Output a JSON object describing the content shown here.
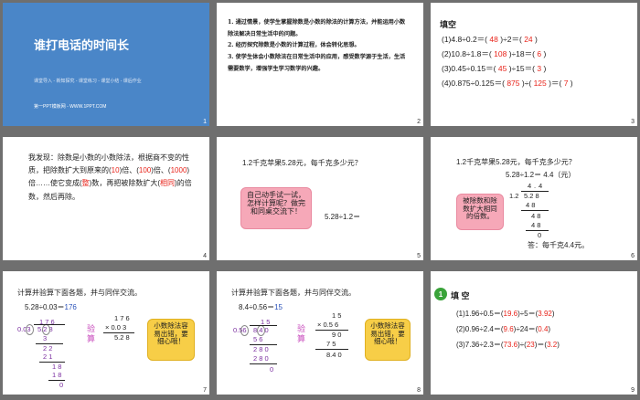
{
  "slide1": {
    "title": "谁打电话的时间长",
    "subtitle": "课堂导入 - 新知探究 - 课堂练习 - 课堂小结 - 课后作业",
    "website": "第一PPT模板网 - WWW.1PPT.COM",
    "number": "1"
  },
  "slide2": {
    "items": [
      "1. 通过情景，使学生掌握除数是小数的除法的计算方法，并能运用小数除法解决日常生活中的问题。",
      "2. 经历探究除数是小数的计算过程，体会转化思想。",
      "3. 使学生体会小数除法在日常生活中的应用，感受数学源于生活，生活需要数学，增强学生学习数学的兴趣。"
    ],
    "number": "2"
  },
  "slide3": {
    "title": "填空",
    "lines": [
      {
        "a": "(1)4.8÷0.2＝(",
        "b": "48",
        "c": ")÷2＝(",
        "d": "24",
        "e": ")"
      },
      {
        "a": "(2)10.8÷1.8＝(",
        "b": "108",
        "c": ")÷18＝(",
        "d": "6",
        "e": ")"
      },
      {
        "a": "(3)0.45÷0.15＝(",
        "b": "45",
        "c": ")÷15＝(",
        "d": "3",
        "e": ")"
      },
      {
        "a": "(4)0.875÷0.125＝(",
        "b": "875",
        "c": ")÷(",
        "d": "125",
        "e": ")＝(",
        "f": "7",
        "g": ")"
      }
    ],
    "number": "3"
  },
  "slide4": {
    "p1": "我发现：除数是小数的小数除法，根据商不变的性质，把除数扩大到原来的(",
    "a1": "10",
    "p2": ")倍、(",
    "a2": "100",
    "p3": ")倍、(",
    "a3": "1000",
    "p4": ")倍……使它变成(",
    "a4": "整",
    "p5": ")数，再把被除数扩大(",
    "a5": "相同",
    "p6": ")的倍数，然后再除。",
    "number": "4"
  },
  "slide5": {
    "question": "1.2千克苹果5.28元，每千克多少元？",
    "bubble": "自己动手试一试，怎样计算呢？做完和同桌交流下！",
    "expr": "5.28÷1.2＝",
    "number": "5"
  },
  "slide6": {
    "question": "1.2千克苹果5.28元，每千克多少元？",
    "expr": "5.28÷1.2＝ 4.4（元）",
    "bubble": "被除数和除数扩大相同的倍数。",
    "answer": "答：每千克4.4元。",
    "div": {
      "q1": "4",
      "q2": ".",
      "q3": "4",
      "divisor": "1.2",
      "dividend": "5.2 8",
      "r1": "4 8",
      "r2": "4 8",
      "r3": "4 8",
      "r4": "0"
    },
    "number": "6"
  },
  "slide7": {
    "header": "计算并验算下面各题，并与同伴交流。",
    "expr": "5.28÷0.03＝",
    "ans": "176",
    "divisor": "0.03",
    "quotient": "1 7 6",
    "dividend": "5.2 8",
    "steps": [
      "3",
      "2 2",
      "2 1",
      "1 8",
      "1 8",
      "0"
    ],
    "check_label": "验算",
    "check": [
      "1 7 6",
      "× 0.0 3",
      "5.2 8"
    ],
    "bubble": "小数除法容易出错，要细心哦！",
    "number": "7"
  },
  "slide8": {
    "header": "计算并验算下面各题，并与同伴交流。",
    "expr": "8.4÷0.56＝",
    "ans": "15",
    "divisor": "0.56",
    "quotient": "1 5",
    "dividend": "8.4 0",
    "steps": [
      "5 6",
      "2 8 0",
      "2 8 0",
      "0"
    ],
    "check_label": "验算",
    "check": [
      "1 5",
      "× 0.5 6",
      "9 0",
      "7 5",
      "8.4 0"
    ],
    "bubble": "小数除法容易出错，要细心哦！",
    "number": "8"
  },
  "slide9": {
    "badge": "1",
    "title": "填 空",
    "lines": [
      {
        "a": "(1)1.96÷0.5＝(",
        "b": "19.6",
        "c": ")÷5＝(",
        "d": "3.92",
        "e": ")"
      },
      {
        "a": "(2)0.96÷2.4＝(",
        "b": "9.6",
        "c": ")÷24＝(",
        "d": "0.4",
        "e": ")"
      },
      {
        "a": "(3)7.36÷2.3＝(",
        "b": "73.6",
        "c": ")÷(",
        "d": "23",
        "e": ")＝(",
        "f": "3.2",
        "g": ")"
      }
    ],
    "number": "9"
  }
}
